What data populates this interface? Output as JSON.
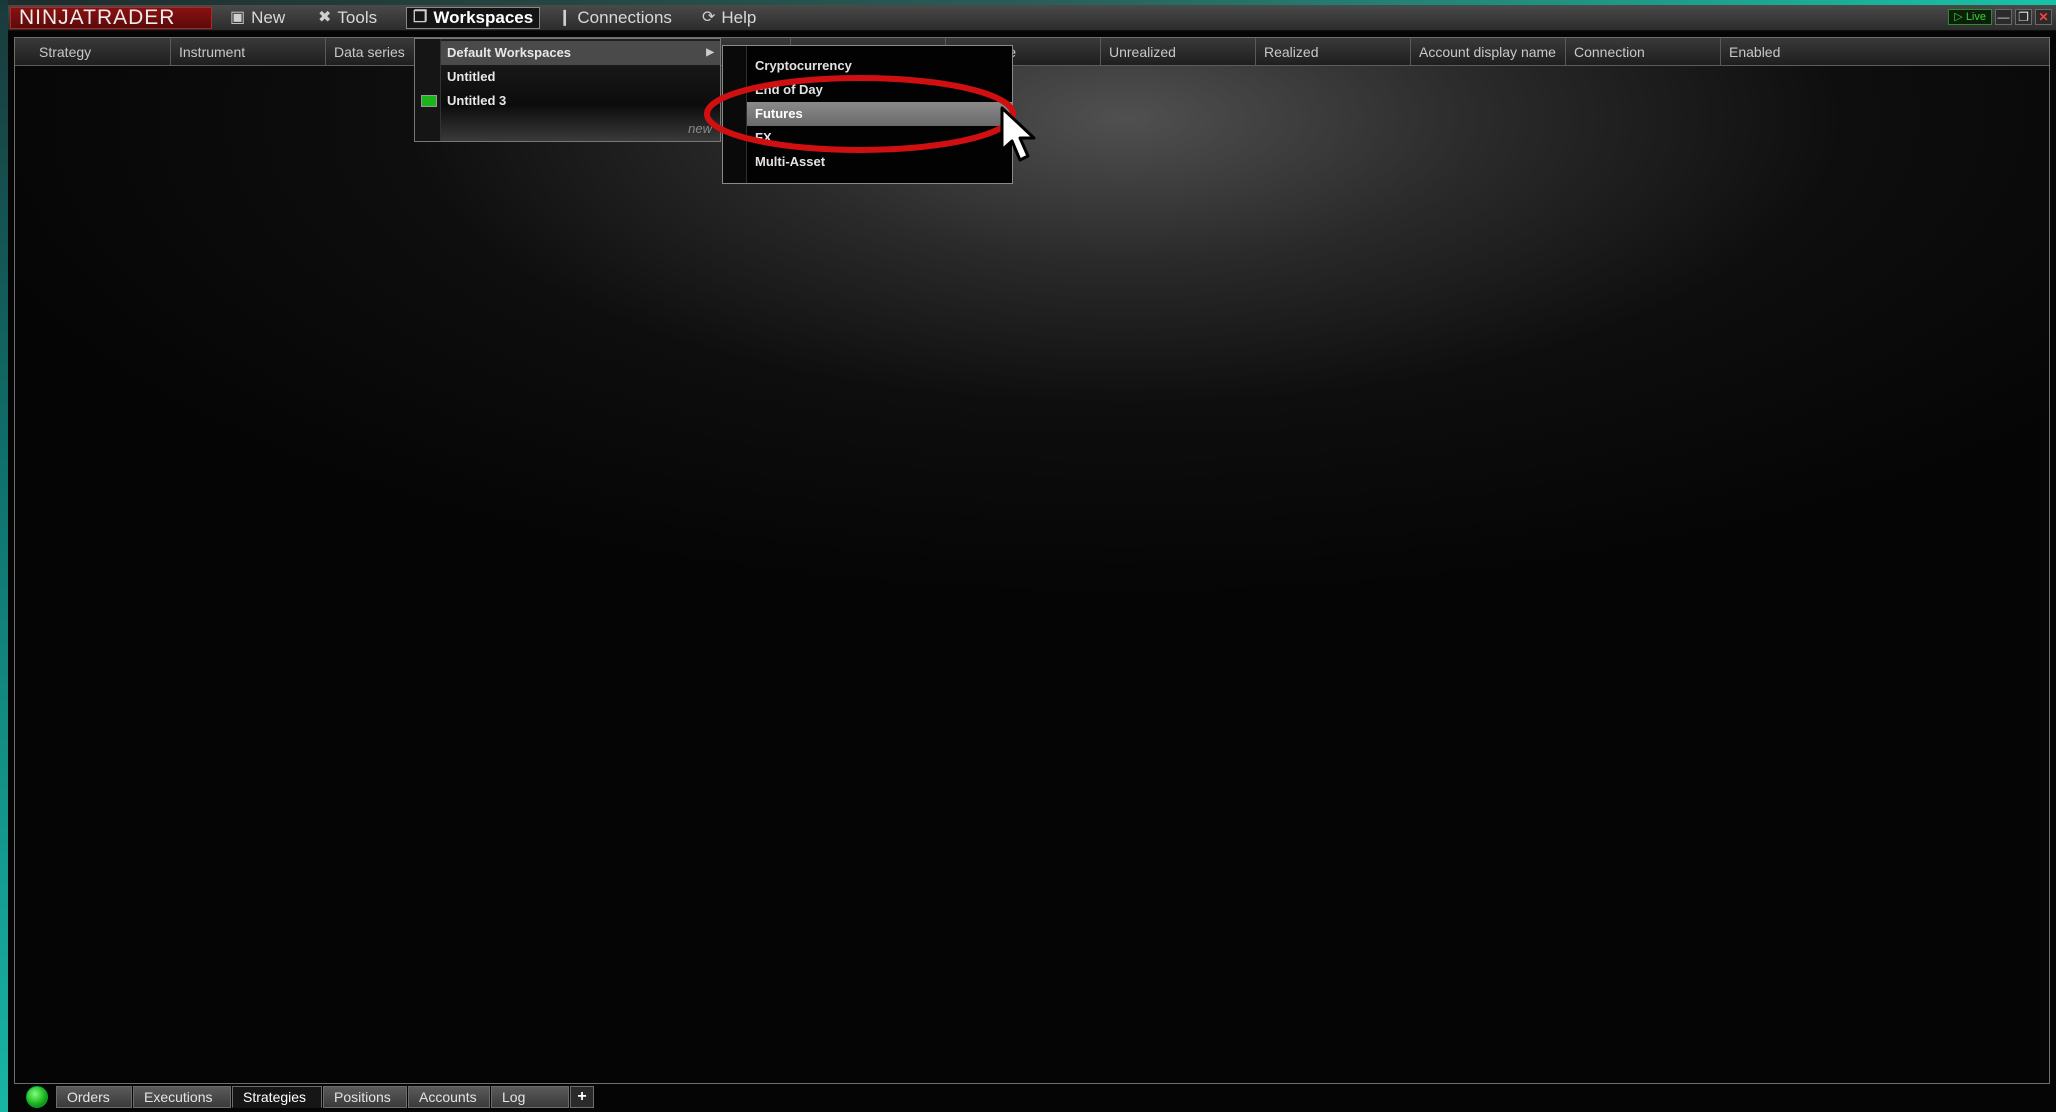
{
  "app": {
    "logo": "NINJATRADER"
  },
  "menubar": {
    "items": [
      {
        "label": "New",
        "icon": "new-window-icon"
      },
      {
        "label": "Tools",
        "icon": "tools-icon"
      },
      {
        "label": "Workspaces",
        "icon": "workspaces-icon"
      },
      {
        "label": "Connections",
        "icon": "plug-icon"
      },
      {
        "label": "Help",
        "icon": "help-icon"
      }
    ],
    "live_badge": "Live"
  },
  "grid": {
    "columns": [
      "Strategy",
      "Instrument",
      "Data series",
      "",
      "",
      "",
      "Avg. price",
      "Unrealized",
      "Realized",
      "Account display name",
      "Connection",
      "Enabled"
    ]
  },
  "workspaces_menu": {
    "items": [
      "Default Workspaces",
      "Untitled",
      "Untitled 3"
    ],
    "footer": "new"
  },
  "default_workspaces_submenu": {
    "items": [
      "Cryptocurrency",
      "End of Day",
      "Futures",
      "FX",
      "Multi-Asset"
    ],
    "selected": "Futures"
  },
  "bottom_tabs": [
    "Orders",
    "Executions",
    "Strategies",
    "Positions",
    "Accounts",
    "Log"
  ],
  "active_tab": "Strategies",
  "colors": {
    "accent_red": "#d01010",
    "status_green": "#1fb51f",
    "logo_bg": "#7a0e0e"
  }
}
